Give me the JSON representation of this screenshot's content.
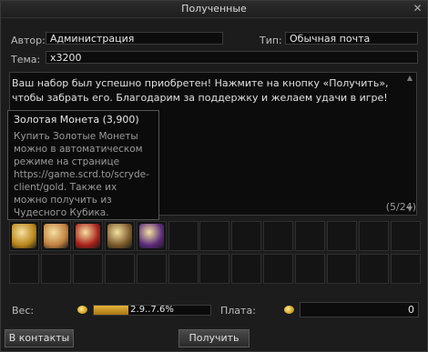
{
  "window": {
    "title": "Полученные"
  },
  "fields": {
    "author_label": "Автор:",
    "author_value": "Администрация",
    "type_label": "Тип:",
    "type_value": "Обычная почта",
    "subject_label": "Тема:",
    "subject_value": "x3200"
  },
  "message": {
    "text": "Ваш набор был успешно приобретен! Нажмите на кнопку «Получить», чтобы забрать его. Благодарим за поддержку и желаем удачи в игре!"
  },
  "tooltip": {
    "title": "Золотая Монета (3,900)",
    "description": "Купить Золотые Монеты можно в автоматическом режиме на странице https://game.scrd.to/scryde-client/gold. Также их можно получить из Чудесного Кубика."
  },
  "attachments": {
    "count": "(5/24)",
    "items": [
      {
        "name": "gold-coin-icon",
        "color": "#b8861a"
      },
      {
        "name": "scroll-icon",
        "color": "#c08040"
      },
      {
        "name": "red-potion-icon",
        "color": "#a8201a"
      },
      {
        "name": "bronze-medallion-icon",
        "color": "#7a5a2a"
      },
      {
        "name": "jester-hat-icon",
        "color": "#5a2a7a"
      }
    ]
  },
  "footer": {
    "weight_label": "Вес:",
    "weight_value": "2.9..7.6%",
    "weight_fraction": 0.3,
    "pay_label": "Плата:",
    "pay_value": "0",
    "contacts_button": "В контакты",
    "receive_button": "Получить"
  }
}
